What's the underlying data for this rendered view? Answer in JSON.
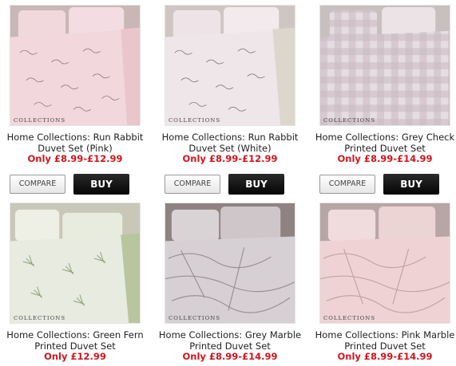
{
  "products": [
    {
      "title": "Home Collections: Run Rabbit Duvet Set (Pink)",
      "price": "Only £8.99-£12.99",
      "compare_label": "COMPARE",
      "buy_label": "BUY",
      "logo": "COLLECTIONS",
      "base_color": "#f2d7dc",
      "pattern": "rabbit-print"
    },
    {
      "title": "Home Collections: Run Rabbit Duvet Set (White)",
      "price": "Only £8.99-£12.99",
      "compare_label": "COMPARE",
      "buy_label": "BUY",
      "logo": "COLLECTIONS",
      "base_color": "#efe6ea",
      "pattern": "rabbit-print"
    },
    {
      "title": "Home Collections: Grey Check Printed Duvet Set",
      "price": "Only £8.99-£14.99",
      "compare_label": "COMPARE",
      "buy_label": "BUY",
      "logo": "COLLECTIONS",
      "base_color": "#ddd2d8",
      "pattern": "check"
    },
    {
      "title": "Home Collections: Green Fern Printed Duvet Set",
      "price": "Only £12.99",
      "logo": "COLLECTIONS",
      "base_color": "#e7ebe0",
      "pattern": "fern"
    },
    {
      "title": "Home Collections: Grey Marble Printed Duvet Set",
      "price": "Only £8.99-£14.99",
      "logo": "COLLECTIONS",
      "base_color": "#d6d0d4",
      "pattern": "marble"
    },
    {
      "title": "Home Collections: Pink Marble Printed Duvet Set",
      "price": "Only £8.99-£14.99",
      "logo": "COLLECTIONS",
      "base_color": "#efd3d4",
      "pattern": "marble"
    }
  ]
}
